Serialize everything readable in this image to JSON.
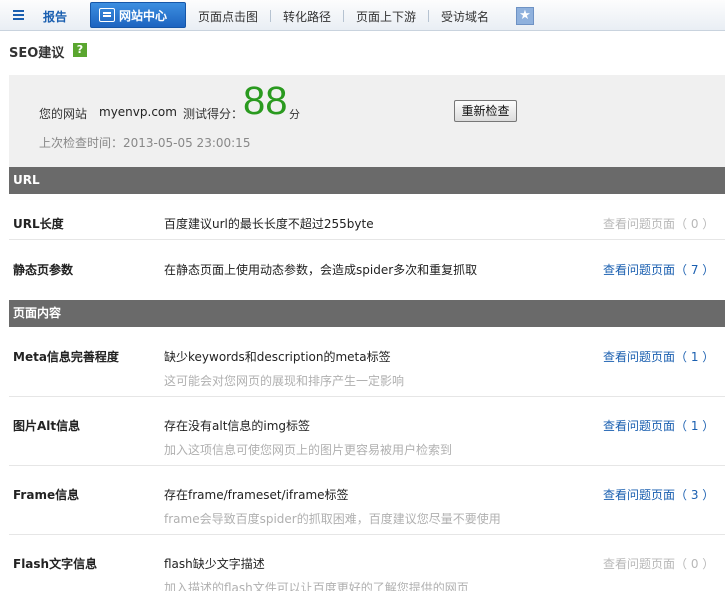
{
  "nav": {
    "report_label": "报告",
    "active_tab": "网站中心",
    "links": [
      "页面点击图",
      "转化路径",
      "页面上下游",
      "受访域名"
    ],
    "star_glyph": "★"
  },
  "seo": {
    "title": "SEO建议",
    "help_glyph": "?"
  },
  "score": {
    "site_label": "您的网站",
    "site_url": "myenvp.com",
    "score_label": "测试得分：",
    "value": "88",
    "unit": "分",
    "recheck_label": "重新检查",
    "last_check": "上次检查时间：2013-05-05 23:00:15"
  },
  "sections": {
    "url": "URL",
    "content": "页面内容"
  },
  "rows": [
    {
      "name": "URL长度",
      "desc": "百度建议url的最长长度不超过255byte",
      "sub": "",
      "link": "查看问题页面（ 0 ）",
      "active": false
    },
    {
      "name": "静态页参数",
      "desc": "在静态页面上使用动态参数，会造成spider多次和重复抓取",
      "sub": "",
      "link": "查看问题页面（ 7 ）",
      "active": true
    },
    {
      "name": "Meta信息完善程度",
      "desc": "缺少keywords和description的meta标签",
      "sub": "这可能会对您网页的展现和排序产生一定影响",
      "link": "查看问题页面（ 1 ）",
      "active": true
    },
    {
      "name": "图片Alt信息",
      "desc": "存在没有alt信息的img标签",
      "sub": "加入这项信息可使您网页上的图片更容易被用户检索到",
      "link": "查看问题页面（ 1 ）",
      "active": true
    },
    {
      "name": "Frame信息",
      "desc": "存在frame/frameset/iframe标签",
      "sub": "frame会导致百度spider的抓取困难，百度建议您尽量不要使用",
      "link": "查看问题页面（ 3 ）",
      "active": true
    },
    {
      "name": "Flash文字信息",
      "desc": "flash缺少文字描述",
      "sub": "加入描述的flash文件可以让百度更好的了解您提供的网页",
      "link": "查看问题页面（ 0 ）",
      "active": false
    }
  ]
}
